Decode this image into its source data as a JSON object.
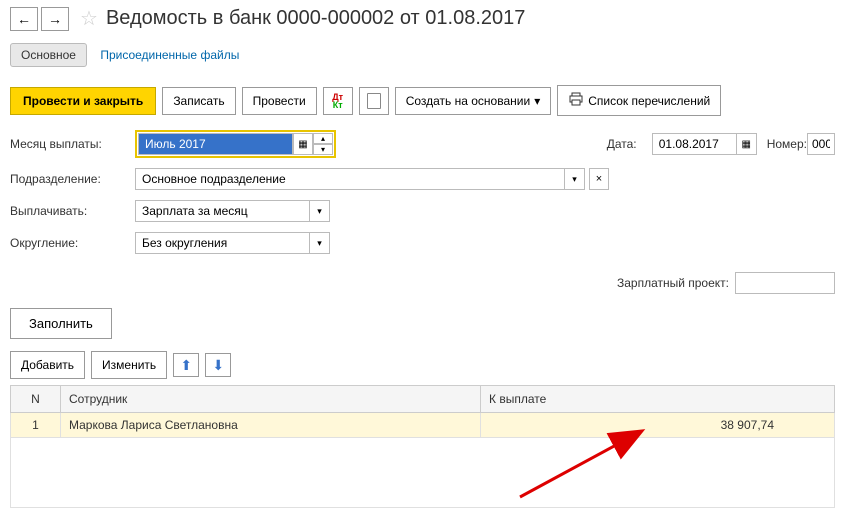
{
  "header": {
    "title": "Ведомость в банк 0000-000002 от 01.08.2017"
  },
  "tabs": {
    "main": "Основное",
    "files": "Присоединенные файлы"
  },
  "toolbar": {
    "post_close": "Провести и закрыть",
    "save": "Записать",
    "post": "Провести",
    "create_based": "Создать на основании",
    "list_transfers": "Список перечислений"
  },
  "form": {
    "month_label": "Месяц выплаты:",
    "month_value": "Июль 2017",
    "date_label": "Дата:",
    "date_value": "01.08.2017",
    "number_label": "Номер:",
    "number_value": "000",
    "dept_label": "Подразделение:",
    "dept_value": "Основное подразделение",
    "pay_label": "Выплачивать:",
    "pay_value": "Зарплата за месяц",
    "round_label": "Округление:",
    "round_value": "Без округления",
    "zp_project_label": "Зарплатный проект:"
  },
  "actions": {
    "fill": "Заполнить",
    "add": "Добавить",
    "edit": "Изменить"
  },
  "table": {
    "col_n": "N",
    "col_employee": "Сотрудник",
    "col_payout": "К выплате",
    "rows": [
      {
        "n": "1",
        "employee": "Маркова Лариса Светлановна",
        "amount": "38 907,74"
      }
    ]
  }
}
